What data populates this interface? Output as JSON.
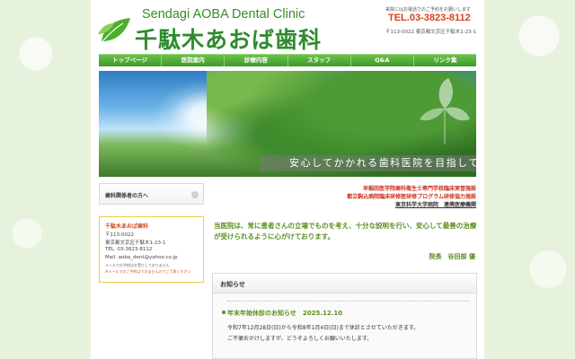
{
  "header": {
    "brand_en": "Sendagi AOBA Dental Clinic",
    "brand_jp": "千駄木あおば歯科",
    "note": "来院にはお電話でのご予約をお願いします",
    "tel_badge": "TEL",
    "tel": "TEL.03-3823-8112",
    "address": "〒113-0022 東京都文京区千駄木1-23-1"
  },
  "nav": {
    "items": [
      {
        "label": "トップページ"
      },
      {
        "label": "医院案内"
      },
      {
        "label": "診療内容"
      },
      {
        "label": "スタッフ"
      },
      {
        "label": "Q&A"
      },
      {
        "label": "リンク集"
      }
    ]
  },
  "hero": {
    "tagline": "安心してかかれる歯科医院を目指して"
  },
  "sidebar": {
    "link_label": "歯科関係者の方へ",
    "link_icon": "chevron-right-icon",
    "info": {
      "title": "千駄木あおば歯科",
      "postal": "〒113-0022",
      "address": "東京都文京区千駄木1-23-1",
      "tel": "TEL. 03-3823-8112",
      "mail": "Mail. aoba_dent@yahoo.co.jp",
      "note": "メールでの予約はお受けしておりません",
      "warn": "※メールでのご予約はできませんのでご了承ください"
    }
  },
  "main": {
    "affiliations": [
      "早稲田医学院歯科衛生士専門学校臨床実習施設",
      "都立駒込病院臨床研修医研修プログラム研修協力施設",
      "東京科学大学病院　連携医療機関"
    ],
    "intro": "当医院は、常に患者さんの立場でものを考え、十分な説明を行い、安心して最善の治療が受けられるように心がけております。",
    "director": "院長　谷田部 優"
  },
  "news": {
    "heading": "お知らせ",
    "items": [
      {
        "title": "年末年始休診のお知らせ　2025.12.10",
        "lines": [
          "令和7年12月28日(日)から令和8年1月4日(日)まで休診とさせていただきます。",
          "ご不便おかけしますが、どうぞよろしくお願いいたします。"
        ]
      }
    ]
  },
  "colors": {
    "brand_green": "#2e8b2e",
    "accent_orange": "#d9401a",
    "text_green": "#5a8f1e"
  }
}
